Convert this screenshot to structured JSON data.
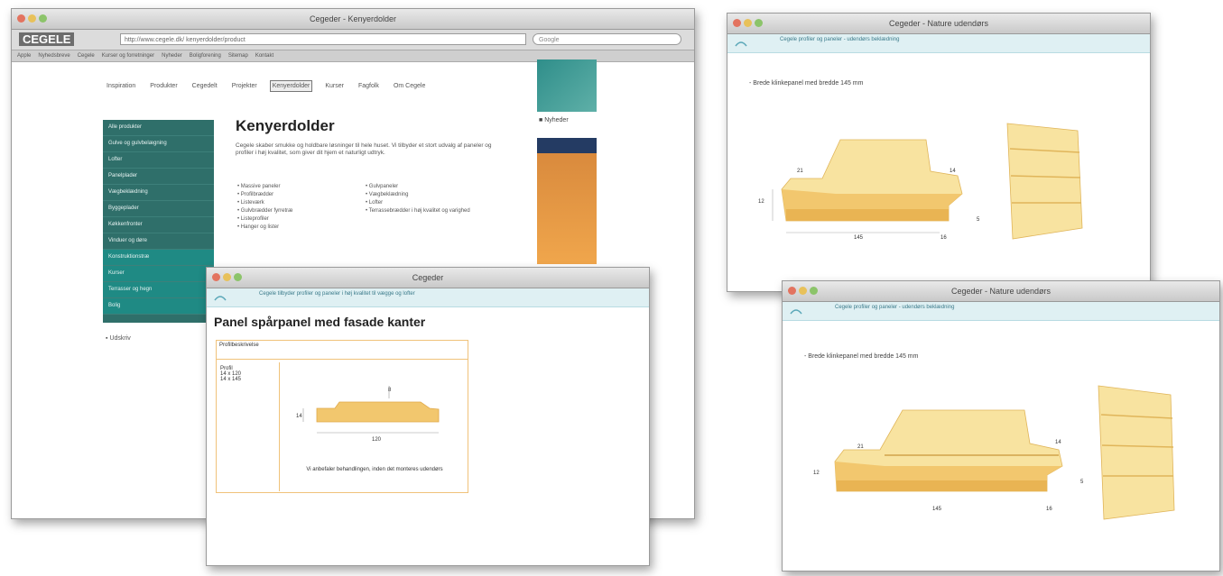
{
  "main_window": {
    "title": "Cegeder - Kenyerdolder",
    "logo": "CEGELE",
    "address": "http://www.cegele.dk/  kenyerdolder/product",
    "search_placeholder": "Google",
    "bookmarks": [
      "Apple",
      "Nyhedsbreve",
      "Cegele",
      "Kurser og forretninger",
      "Nyheder",
      "Boligforening",
      "Sitemap",
      "Kontakt"
    ],
    "nav": [
      "Inspiration",
      "Produkter",
      "Cegedelt",
      "Projekter",
      "Kenyerdolder",
      "Kurser",
      "Fagfolk",
      "Om Cegele"
    ],
    "nav_active_index": 4,
    "side_menu": [
      "Alle produkter",
      "Gulve og gulvbelægning",
      "Lofter",
      "Panelplader",
      "Vægbeklædning",
      "Byggeplader",
      "Køkkenfronter",
      "Vinduer og døre",
      "Konstruktionstræ",
      "Kurser",
      "Terrasser og hegn",
      "Bolig"
    ],
    "side_menu_highlight": [
      8,
      9,
      10,
      11
    ],
    "print_label": "Udskriv",
    "heading": "Kenyerdolder",
    "paragraph": "Cegele skaber smukke og holdbare løsninger til hele huset. Vi tilbyder et stort udvalg af paneler og profiler i høj kvalitet, som giver dit hjem et naturligt udtryk.",
    "bullets_left": [
      "Massive paneler",
      "Profilbrædder",
      "Listeværk",
      "Gulvbrædder fyrretræ",
      "Listeprofiler",
      "Hanger og lister"
    ],
    "bullets_right": [
      "Gulvpaneler",
      "Vægbeklædning",
      "Lofter",
      "Terrassebrædder i høj kvalitet og varighed"
    ],
    "ad_label": "Nyheder"
  },
  "popup_window": {
    "title": "Cegeder",
    "info_text": "Cegele tilbyder profiler og paneler i høj kvalitet til vægge og lofter",
    "heading": "Panel spårpanel med fasade kanter",
    "table_header": "Profilbeskrivelse",
    "list_items": [
      "Profil",
      "14 x 120",
      "14 x 145"
    ],
    "caption": "Vi anbefaler behandlingen, inden det monteres udendørs",
    "dims": [
      "8",
      "14",
      "120"
    ]
  },
  "profile_window_1": {
    "title": "Cegeder - Nature udendørs",
    "info_text": "Cegele profiler og paneler - udendørs beklædning",
    "caption": "- Brede klinkepanel med bredde 145 mm",
    "dims": [
      "21",
      "14",
      "145",
      "12",
      "16",
      "5"
    ]
  },
  "profile_window_2": {
    "title": "Cegeder - Nature udendørs",
    "info_text": "Cegele profiler og paneler - udendørs beklædning",
    "caption": "- Brede klinkepanel med bredde 145 mm",
    "dims": [
      "21",
      "14",
      "145",
      "12",
      "16",
      "5"
    ]
  },
  "colors": {
    "teal": "#2f6f6a",
    "wood_light": "#f8e3a0",
    "wood_mid": "#f2c76e",
    "wood_dark": "#e9b453"
  }
}
